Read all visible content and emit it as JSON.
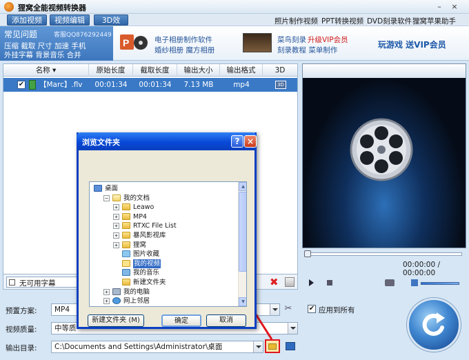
{
  "app": {
    "title": "狸窝全能视频转换器"
  },
  "window_controls": {
    "min": "–",
    "close": "×"
  },
  "tabs": [
    "添加视频",
    "视频编辑",
    "3D效果"
  ],
  "top_links": [
    "照片制作视频",
    "PPT转换视频",
    "DVD刻录软件",
    "狸窝苹果助手"
  ],
  "banner": {
    "faq_title": "常见问题",
    "qq": "客服QQ876292449",
    "faq_line1": "压缩 截取 尺寸 加速 手机",
    "faq_line2": "外挂字幕 背景音乐 合并",
    "promo1_line1": "电子相册制作软件",
    "promo1_line2": "婚纱相册 魔方相册",
    "promo2_line1a": "菜鸟刻录",
    "promo2_line1b": "升级VIP会员",
    "promo2_line2": "刻录教程 菜单制作",
    "promo3": "玩游戏 送VIP会员"
  },
  "file_list": {
    "columns": [
      "名称",
      "原始长度",
      "截取长度",
      "输出大小",
      "输出格式",
      "3D"
    ],
    "rows": [
      {
        "checked": "✔",
        "name": "【Marc】.flv",
        "original": "00:01:34",
        "clip": "00:01:34",
        "size": "7.13 MB",
        "format": "mp4",
        "three_d": "3D"
      }
    ]
  },
  "subtitle": {
    "value": "无可用字幕"
  },
  "player": {
    "timecode": "00:00:00 / 00:00:00"
  },
  "settings": {
    "preset_label": "预置方案:",
    "preset_value": "MP4",
    "quality_label": "视频质量:",
    "quality_value": "中等质",
    "output_label": "输出目录:",
    "output_value": "C:\\Documents and Settings\\Administrator\\桌面",
    "apply_all": "应用到所有",
    "apply_all_checked": "✔"
  },
  "dialog": {
    "title": "浏览文件夹",
    "help": "?",
    "close": "×",
    "tree": [
      {
        "label": "桌面",
        "level": 0,
        "expander": "",
        "icon": "desktop"
      },
      {
        "label": "我的文档",
        "level": 1,
        "expander": "−",
        "icon": "docs"
      },
      {
        "label": "Leawo",
        "level": 2,
        "expander": "+",
        "icon": "folder"
      },
      {
        "label": "MP4",
        "level": 2,
        "expander": "+",
        "icon": "folder"
      },
      {
        "label": "RTXC File List",
        "level": 2,
        "expander": "+",
        "icon": "folder"
      },
      {
        "label": "暴风影视库",
        "level": 2,
        "expander": "+",
        "icon": "folder"
      },
      {
        "label": "狸窝",
        "level": 2,
        "expander": "+",
        "icon": "folder"
      },
      {
        "label": "图片收藏",
        "level": 2,
        "expander": "",
        "icon": "pictures"
      },
      {
        "label": "我的视频",
        "level": 2,
        "expander": "",
        "icon": "videos",
        "selected": true
      },
      {
        "label": "我的音乐",
        "level": 2,
        "expander": "",
        "icon": "music"
      },
      {
        "label": "新建文件夹",
        "level": 2,
        "expander": "",
        "icon": "folder"
      },
      {
        "label": "我的电脑",
        "level": 1,
        "expander": "+",
        "icon": "computer"
      },
      {
        "label": "网上邻居",
        "level": 1,
        "expander": "+",
        "icon": "network"
      }
    ],
    "new_folder": "新建文件夹 (M)",
    "ok": "确定",
    "cancel": "取消"
  },
  "colors": {
    "accent": "#3a79c6",
    "title_blue": "#0a3fc2",
    "highlight_red": "#e0161e"
  }
}
